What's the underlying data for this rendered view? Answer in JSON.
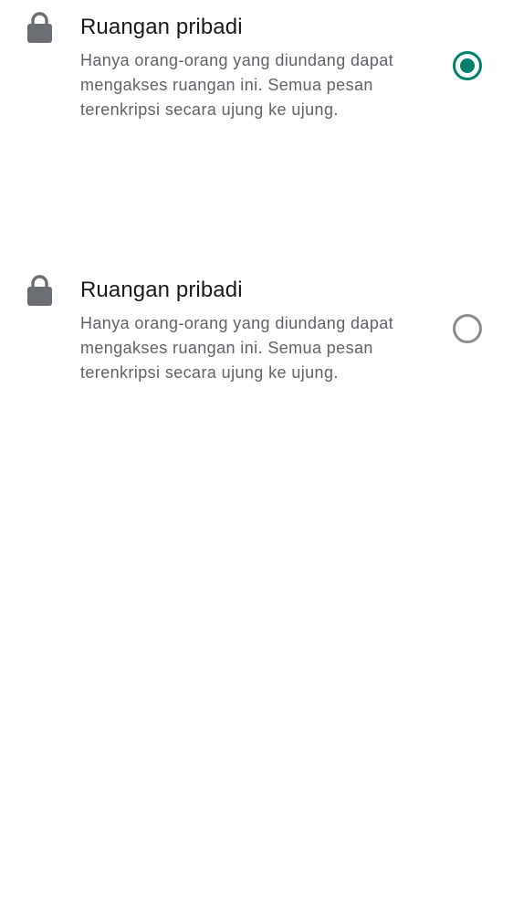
{
  "options": [
    {
      "icon": "lock-icon",
      "title": "Ruangan pribadi",
      "description": "Hanya orang-orang yang diundang dapat mengakses ruangan ini. Semua pesan terenkripsi secara ujung ke ujung.",
      "selected": true
    },
    {
      "icon": "lock-icon",
      "title": "Ruangan pribadi",
      "description": "Hanya orang-orang yang diundang dapat mengakses ruangan ini. Semua pesan terenkripsi secara ujung ke ujung.",
      "selected": false
    }
  ],
  "colors": {
    "accent": "#008069",
    "icon": "#6b6e73",
    "title": "#1b1b1b",
    "description": "#5f6368",
    "radio_unchecked": "#8a8d91",
    "background": "#ffffff"
  }
}
